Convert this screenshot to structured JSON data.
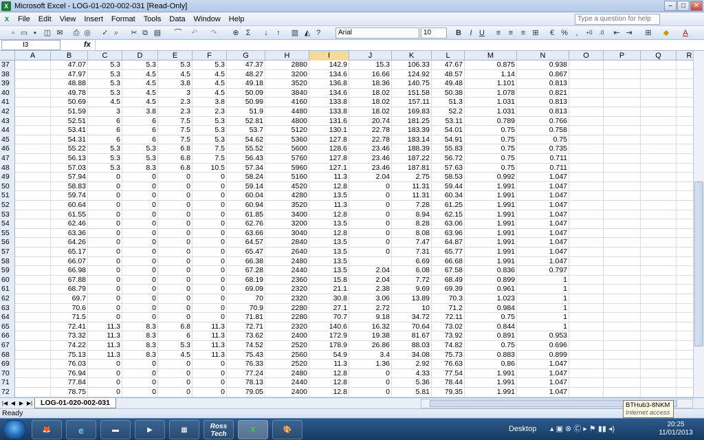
{
  "window": {
    "title": "Microsoft Excel - LOG-01-020-002-031  [Read-Only]"
  },
  "menu": [
    "File",
    "Edit",
    "View",
    "Insert",
    "Format",
    "Tools",
    "Data",
    "Window",
    "Help"
  ],
  "help_placeholder": "Type a question for help",
  "font": {
    "name": "Arial",
    "size": "10"
  },
  "name_box": "I3",
  "fx_label": "fx",
  "columns": [
    "A",
    "B",
    "C",
    "D",
    "E",
    "F",
    "G",
    "H",
    "I",
    "J",
    "K",
    "L",
    "M",
    "N",
    "O",
    "P",
    "Q",
    "R"
  ],
  "selected_column": "I",
  "rows": [
    {
      "n": "37",
      "c": [
        "",
        "47.07",
        "5.3",
        "5.3",
        "5.3",
        "5.3",
        "47.37",
        "2880",
        "142.9",
        "15.3",
        "106.33",
        "47.67",
        "0.875",
        "0.938"
      ]
    },
    {
      "n": "38",
      "c": [
        "",
        "47.97",
        "5.3",
        "4.5",
        "4.5",
        "4.5",
        "48.27",
        "3200",
        "134.6",
        "16.66",
        "124.92",
        "48.57",
        "1.14",
        "0.867"
      ]
    },
    {
      "n": "39",
      "c": [
        "",
        "48.88",
        "5.3",
        "4.5",
        "3.8",
        "4.5",
        "49.18",
        "3520",
        "136.8",
        "18.36",
        "140.75",
        "49.48",
        "1.101",
        "0.813"
      ]
    },
    {
      "n": "40",
      "c": [
        "",
        "49.78",
        "5.3",
        "4.5",
        "3",
        "4.5",
        "50.09",
        "3840",
        "134.6",
        "18.02",
        "151.58",
        "50.38",
        "1.078",
        "0.821"
      ]
    },
    {
      "n": "41",
      "c": [
        "",
        "50.69",
        "4.5",
        "4.5",
        "2.3",
        "3.8",
        "50.99",
        "4160",
        "133.8",
        "18.02",
        "157.11",
        "51.3",
        "1.031",
        "0.813"
      ]
    },
    {
      "n": "42",
      "c": [
        "",
        "51.59",
        "3",
        "3.8",
        "2.3",
        "2.3",
        "51.9",
        "4480",
        "133.8",
        "18.02",
        "169.83",
        "52.2",
        "1.031",
        "0.813"
      ]
    },
    {
      "n": "43",
      "c": [
        "",
        "52.51",
        "6",
        "6",
        "7.5",
        "5.3",
        "52.81",
        "4800",
        "131.6",
        "20.74",
        "181.25",
        "53.11",
        "0.789",
        "0.766"
      ]
    },
    {
      "n": "44",
      "c": [
        "",
        "53.41",
        "6",
        "6",
        "7.5",
        "5.3",
        "53.7",
        "5120",
        "130.1",
        "22.78",
        "183.39",
        "54.01",
        "0.75",
        "0.758"
      ]
    },
    {
      "n": "45",
      "c": [
        "",
        "54.31",
        "6",
        "6",
        "7.5",
        "5.3",
        "54.62",
        "5360",
        "127.8",
        "22.78",
        "183.14",
        "54.91",
        "0.75",
        "0.75"
      ]
    },
    {
      "n": "46",
      "c": [
        "",
        "55.22",
        "5.3",
        "5.3",
        "6.8",
        "7.5",
        "55.52",
        "5600",
        "128.6",
        "23.46",
        "188.39",
        "55.83",
        "0.75",
        "0.735"
      ]
    },
    {
      "n": "47",
      "c": [
        "",
        "56.13",
        "5.3",
        "5.3",
        "6.8",
        "7.5",
        "56.43",
        "5760",
        "127.8",
        "23.46",
        "187.22",
        "56.72",
        "0.75",
        "0.711"
      ]
    },
    {
      "n": "48",
      "c": [
        "",
        "57.03",
        "5.3",
        "8.3",
        "6.8",
        "10.5",
        "57.34",
        "5960",
        "127.1",
        "23.46",
        "187.81",
        "57.63",
        "0.75",
        "0.711"
      ]
    },
    {
      "n": "49",
      "c": [
        "",
        "57.94",
        "0",
        "0",
        "0",
        "0",
        "58.24",
        "5160",
        "11.3",
        "2.04",
        "2.75",
        "58.53",
        "0.992",
        "1.047"
      ]
    },
    {
      "n": "50",
      "c": [
        "",
        "58.83",
        "0",
        "0",
        "0",
        "0",
        "59.14",
        "4520",
        "12.8",
        "0",
        "11.31",
        "59.44",
        "1.991",
        "1.047"
      ]
    },
    {
      "n": "51",
      "c": [
        "",
        "59.74",
        "0",
        "0",
        "0",
        "0",
        "60.04",
        "4280",
        "13.5",
        "0",
        "11.31",
        "60.34",
        "1.991",
        "1.047"
      ]
    },
    {
      "n": "52",
      "c": [
        "",
        "60.64",
        "0",
        "0",
        "0",
        "0",
        "60.94",
        "3520",
        "11.3",
        "0",
        "7.28",
        "61.25",
        "1.991",
        "1.047"
      ]
    },
    {
      "n": "53",
      "c": [
        "",
        "61.55",
        "0",
        "0",
        "0",
        "0",
        "61.85",
        "3400",
        "12.8",
        "0",
        "8.94",
        "62.15",
        "1.991",
        "1.047"
      ]
    },
    {
      "n": "54",
      "c": [
        "",
        "62.46",
        "0",
        "0",
        "0",
        "0",
        "62.76",
        "3200",
        "13.5",
        "0",
        "8.28",
        "63.06",
        "1.991",
        "1.047"
      ]
    },
    {
      "n": "55",
      "c": [
        "",
        "63.36",
        "0",
        "0",
        "0",
        "0",
        "63.66",
        "3040",
        "12.8",
        "0",
        "8.08",
        "63.96",
        "1.991",
        "1.047"
      ]
    },
    {
      "n": "56",
      "c": [
        "",
        "64.26",
        "0",
        "0",
        "0",
        "0",
        "64.57",
        "2840",
        "13.5",
        "0",
        "7.47",
        "64.87",
        "1.991",
        "1.047"
      ]
    },
    {
      "n": "57",
      "c": [
        "",
        "65.17",
        "0",
        "0",
        "0",
        "0",
        "65.47",
        "2640",
        "13.5",
        "0",
        "7.31",
        "65.77",
        "1.991",
        "1.047"
      ]
    },
    {
      "n": "58",
      "c": [
        "",
        "66.07",
        "0",
        "0",
        "0",
        "0",
        "66.38",
        "2480",
        "13.5",
        "",
        "6.69",
        "66.68",
        "1.991",
        "1.047"
      ]
    },
    {
      "n": "59",
      "c": [
        "",
        "66.98",
        "0",
        "0",
        "0",
        "0",
        "67.28",
        "2440",
        "13.5",
        "2.04",
        "6.08",
        "67.58",
        "0.836",
        "0.797"
      ]
    },
    {
      "n": "60",
      "c": [
        "",
        "67.88",
        "0",
        "0",
        "0",
        "0",
        "68.19",
        "2360",
        "15.8",
        "2.04",
        "7.72",
        "68.49",
        "0.899",
        "1"
      ]
    },
    {
      "n": "61",
      "c": [
        "",
        "68.79",
        "0",
        "0",
        "0",
        "0",
        "69.09",
        "2320",
        "21.1",
        "2.38",
        "9.69",
        "69.39",
        "0.961",
        "1"
      ]
    },
    {
      "n": "62",
      "c": [
        "",
        "69.7",
        "0",
        "0",
        "0",
        "0",
        "70",
        "2320",
        "30.8",
        "3.06",
        "13.89",
        "70.3",
        "1.023",
        "1"
      ]
    },
    {
      "n": "63",
      "c": [
        "",
        "70.6",
        "0",
        "0",
        "0",
        "0",
        "70.9",
        "2280",
        "27.1",
        "2.72",
        "10",
        "71.2",
        "0.984",
        "1"
      ]
    },
    {
      "n": "64",
      "c": [
        "",
        "71.5",
        "0",
        "0",
        "0",
        "0",
        "71.81",
        "2280",
        "70.7",
        "9.18",
        "34.72",
        "72.11",
        "0.75",
        "1"
      ]
    },
    {
      "n": "65",
      "c": [
        "",
        "72.41",
        "11.3",
        "8.3",
        "6.8",
        "11.3",
        "72.71",
        "2320",
        "140.6",
        "16.32",
        "70.64",
        "73.02",
        "0.844",
        "1"
      ]
    },
    {
      "n": "66",
      "c": [
        "",
        "73.32",
        "11.3",
        "8.3",
        "6",
        "11.3",
        "73.62",
        "2400",
        "172.9",
        "19.38",
        "81.67",
        "73.92",
        "0.891",
        "0.953"
      ]
    },
    {
      "n": "67",
      "c": [
        "",
        "74.22",
        "11.3",
        "8.3",
        "5.3",
        "11.3",
        "74.52",
        "2520",
        "178.9",
        "26.86",
        "88.03",
        "74.82",
        "0.75",
        "0.696"
      ]
    },
    {
      "n": "68",
      "c": [
        "",
        "75.13",
        "11.3",
        "8.3",
        "4.5",
        "11.3",
        "75.43",
        "2560",
        "54.9",
        "3.4",
        "34.08",
        "75.73",
        "0.883",
        "0.899"
      ]
    },
    {
      "n": "69",
      "c": [
        "",
        "76.03",
        "0",
        "0",
        "0",
        "0",
        "76.33",
        "2520",
        "11.3",
        "1.36",
        "2.92",
        "76.63",
        "0.86",
        "1.047"
      ]
    },
    {
      "n": "70",
      "c": [
        "",
        "76.94",
        "0",
        "0",
        "0",
        "0",
        "77.24",
        "2480",
        "12.8",
        "0",
        "4.33",
        "77.54",
        "1.991",
        "1.047"
      ]
    },
    {
      "n": "71",
      "c": [
        "",
        "77.84",
        "0",
        "0",
        "0",
        "0",
        "78.13",
        "2440",
        "12.8",
        "0",
        "5.36",
        "78.44",
        "1.991",
        "1.047"
      ]
    },
    {
      "n": "72",
      "c": [
        "",
        "78.75",
        "0",
        "0",
        "0",
        "0",
        "79.05",
        "2400",
        "12.8",
        "0",
        "5.81",
        "79.35",
        "1.991",
        "1.047"
      ]
    }
  ],
  "sheet_tab": "LOG-01-020-002-031",
  "status": "Ready",
  "tooltip": {
    "title": "BTHub3-8NKM",
    "sub": "Internet access"
  },
  "taskbar": {
    "desktop": "Desktop",
    "ross_label": "Ross Tech",
    "time": "20:25",
    "date": "11/01/2013"
  }
}
